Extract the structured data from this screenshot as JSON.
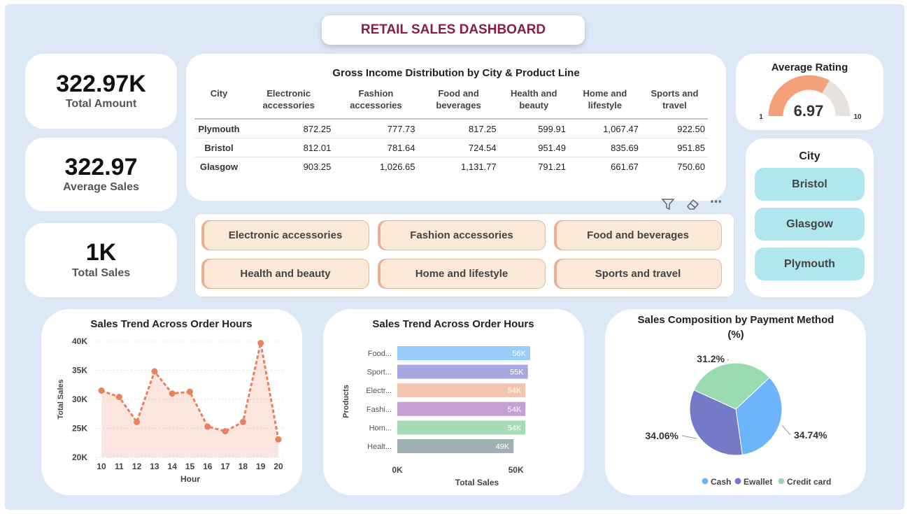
{
  "title": "RETAIL SALES DASHBOARD",
  "kpis": [
    {
      "value": "322.97K",
      "label": "Total Amount"
    },
    {
      "value": "322.97",
      "label": "Average Sales"
    },
    {
      "value": "1K",
      "label": "Total Sales"
    }
  ],
  "gross_income": {
    "title": "Gross Income Distribution by City & Product Line",
    "columns": [
      "City",
      "Electronic accessories",
      "Fashion accessories",
      "Food and beverages",
      "Health and beauty",
      "Home and lifestyle",
      "Sports and travel"
    ],
    "rows": [
      [
        "Plymouth",
        "872.25",
        "777.73",
        "817.25",
        "599.91",
        "1,067.47",
        "922.50"
      ],
      [
        "Bristol",
        "812.01",
        "781.64",
        "724.54",
        "951.49",
        "835.69",
        "951.85"
      ],
      [
        "Glasgow",
        "903.25",
        "1,026.65",
        "1,131.77",
        "791.21",
        "661.67",
        "750.60"
      ]
    ]
  },
  "rating": {
    "title": "Average Rating",
    "value": "6.97",
    "min": "1",
    "max": "10",
    "fraction": 0.663,
    "fill_color": "#f4a07a",
    "track_color": "#e8e2de"
  },
  "product_slicer": {
    "toolbar": {
      "filter_icon": "filter-icon",
      "eraser_icon": "eraser-icon",
      "more_glyph": "⋯"
    },
    "items": [
      "Electronic accessories",
      "Fashion accessories",
      "Food and beverages",
      "Health and beauty",
      "Home and lifestyle",
      "Sports and travel"
    ]
  },
  "city_slicer": {
    "title": "City",
    "items": [
      "Bristol",
      "Glasgow",
      "Plymouth"
    ]
  },
  "chart_data": [
    {
      "type": "area",
      "title": "Sales Trend Across Order Hours",
      "xlabel": "Hour",
      "ylabel": "Total Sales",
      "x": [
        10,
        11,
        12,
        13,
        14,
        15,
        16,
        17,
        18,
        19,
        20
      ],
      "values": [
        31500,
        30400,
        26100,
        34800,
        31000,
        31300,
        25300,
        24500,
        26100,
        39700,
        23100
      ],
      "yticks": [
        "20K",
        "25K",
        "30K",
        "35K",
        "40K"
      ],
      "ylim": [
        20000,
        40000
      ],
      "grid": true,
      "color": "#e8825e"
    },
    {
      "type": "bar",
      "orientation": "horizontal",
      "title": "Sales Trend Across Order Hours",
      "xlabel": "Total Sales",
      "ylabel": "Products",
      "categories": [
        "Food...",
        "Sport...",
        "Electr...",
        "Fashi...",
        "Hom...",
        "Healt..."
      ],
      "values": [
        56000,
        55000,
        54000,
        54000,
        54000,
        49000
      ],
      "data_labels": [
        "56K",
        "55K",
        "54K",
        "54K",
        "54K",
        "49K"
      ],
      "colors": [
        "#99cdf9",
        "#a5a7de",
        "#f3c4ae",
        "#c59ed4",
        "#a6dbb5",
        "#9fb0b5"
      ],
      "xticks": [
        "0K",
        "50K"
      ],
      "xlim": [
        0,
        56000
      ]
    },
    {
      "type": "pie",
      "title": "Sales Composition by Payment Method (%)",
      "labels": [
        "Cash",
        "Ewallet",
        "Credit card"
      ],
      "values": [
        34.74,
        34.06,
        31.2
      ],
      "value_labels": [
        "34.74%",
        "34.06%",
        "31.2%"
      ],
      "colors": [
        "#6cb5fb",
        "#7479c8",
        "#9bdbb0"
      ],
      "legend": "bottom"
    }
  ]
}
